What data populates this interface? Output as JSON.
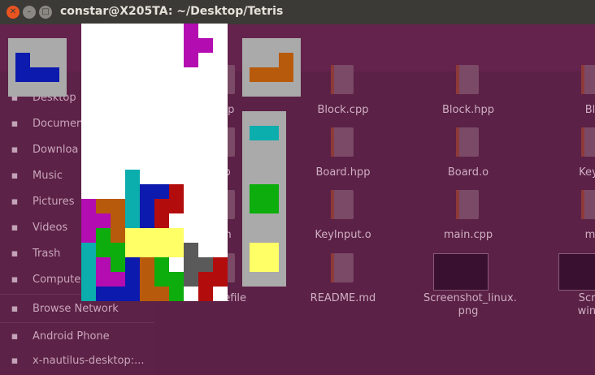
{
  "window": {
    "title": "constar@X205TA: ~/Desktop/Tetris"
  },
  "sidebar": {
    "items": [
      {
        "label": "Desktop",
        "icon": "desktop-icon"
      },
      {
        "label": "Documen",
        "icon": "documents-icon"
      },
      {
        "label": "Downloa",
        "icon": "downloads-icon"
      },
      {
        "label": "Music",
        "icon": "music-icon"
      },
      {
        "label": "Pictures",
        "icon": "pictures-icon"
      },
      {
        "label": "Videos",
        "icon": "videos-icon"
      },
      {
        "label": "Trash",
        "icon": "trash-icon"
      },
      {
        "label": "Compute",
        "icon": "computer-icon"
      },
      {
        "label": "Browse Network",
        "icon": "network-icon"
      },
      {
        "label": "Android Phone",
        "icon": "phone-icon"
      },
      {
        "label": "x-nautilus-desktop:...",
        "icon": "desktop-folder-icon"
      }
    ]
  },
  "files": [
    {
      "name": "hpp"
    },
    {
      "name": "Block.cpp"
    },
    {
      "name": "Block.hpp"
    },
    {
      "name": "Blo"
    },
    {
      "name": "cp"
    },
    {
      "name": "Board.hpp"
    },
    {
      "name": "Board.o"
    },
    {
      "name": "KeyIn"
    },
    {
      "name": "t.h"
    },
    {
      "name": "KeyInput.o"
    },
    {
      "name": "main.cpp"
    },
    {
      "name": "ma"
    },
    {
      "name": "Makefile"
    },
    {
      "name": "README.md"
    },
    {
      "name": "Screenshot_linux.\npng"
    },
    {
      "name": "Scree\nwinde"
    }
  ],
  "game": {
    "colors": {
      "magenta": "#b30cb0",
      "blue": "#0c1aae",
      "orange": "#b85a0c",
      "cyan": "#0cadad",
      "red": "#b30c0c",
      "green": "#0cad0c",
      "yellow": "#ffff66",
      "gray": "#5a5a5a"
    }
  }
}
